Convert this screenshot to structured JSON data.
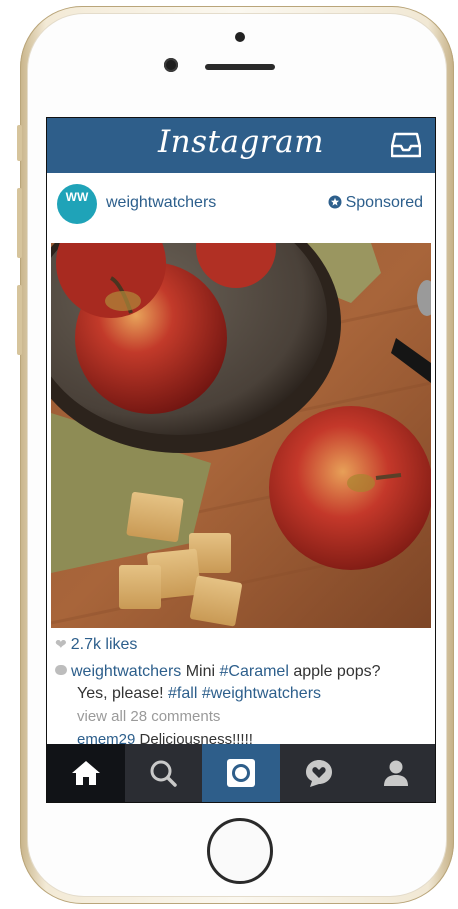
{
  "header": {
    "title": "Instagram",
    "inbox_icon": "inbox-tray-icon",
    "color": "#2e5e8a"
  },
  "post": {
    "username": "weightwatchers",
    "avatar_text": "WW",
    "avatar_color": "#1fa3b8",
    "sponsored_label": "Sponsored",
    "likes": "2.7k likes",
    "caption": {
      "user": "weightwatchers",
      "text_1": " Mini ",
      "tag_1": "#Caramel",
      "text_2": " apple pops?",
      "text_3": "Yes, please! ",
      "tag_2": "#fall",
      "tag_3": "#weightwatchers"
    },
    "view_all_comments": "view all 28 comments",
    "comment": {
      "user": "emem29",
      "text": " Deliciousness!!!!!"
    }
  },
  "tabbar": {
    "tabs": [
      {
        "icon": "home-icon"
      },
      {
        "icon": "search-icon"
      },
      {
        "icon": "camera-icon"
      },
      {
        "icon": "activity-heart-icon"
      },
      {
        "icon": "profile-icon"
      }
    ],
    "active_home": true,
    "active_camera_color": "#2e5e8a"
  }
}
